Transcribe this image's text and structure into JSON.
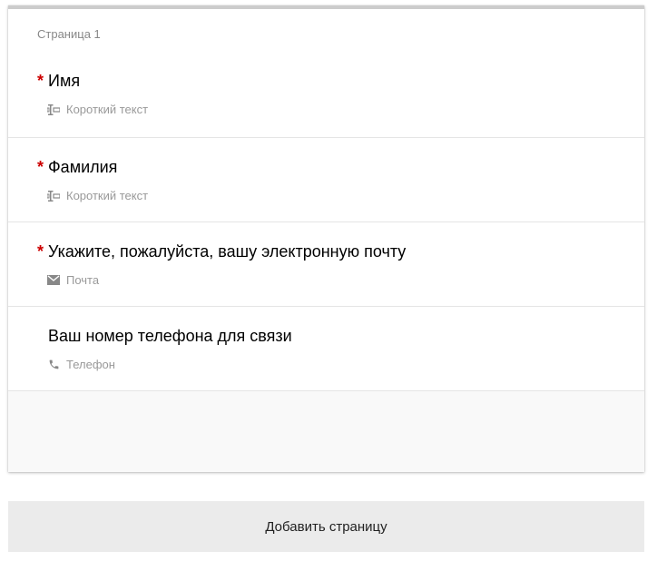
{
  "page": {
    "title": "Страница 1"
  },
  "questions": [
    {
      "title": "Имя",
      "required": "*",
      "type_label": "Короткий текст",
      "type_icon": "short-text-icon"
    },
    {
      "title": "Фамилия",
      "required": "*",
      "type_label": "Короткий текст",
      "type_icon": "short-text-icon"
    },
    {
      "title": "Укажите, пожалуйста, вашу электронную почту",
      "required": "*",
      "type_label": "Почта",
      "type_icon": "mail-icon"
    },
    {
      "title": "Ваш номер телефона для связи",
      "required": "",
      "type_label": "Телефон",
      "type_icon": "phone-icon"
    }
  ],
  "actions": {
    "add_page_label": "Добавить страницу"
  },
  "colors": {
    "required": "#cc0000",
    "muted_text": "#999999",
    "button_bg": "#ebebeb"
  }
}
